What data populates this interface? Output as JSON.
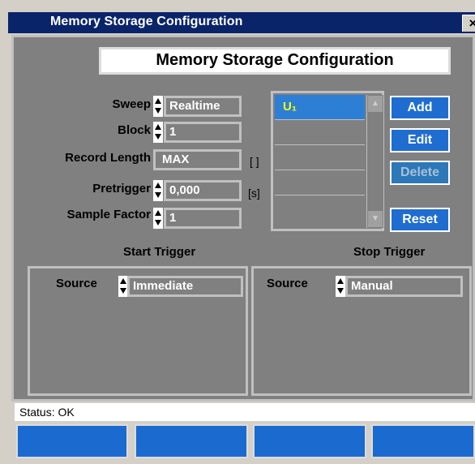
{
  "window": {
    "title": "Memory Storage Configuration",
    "close_label": "×"
  },
  "heading": "Memory Storage Configuration",
  "fields": {
    "sweep": {
      "label": "Sweep",
      "value": "Realtime"
    },
    "block": {
      "label": "Block",
      "value": "1"
    },
    "record_length": {
      "label": "Record Length",
      "value": "MAX",
      "unit": "[ ]"
    },
    "pretrigger": {
      "label": "Pretrigger",
      "value": "0,000",
      "unit": "[s]"
    },
    "sample_factor": {
      "label": "Sample Factor",
      "value": "1"
    }
  },
  "list": {
    "items": [
      "U₁"
    ],
    "selected_index": 0,
    "scroll_up": "▲",
    "scroll_down": "▼"
  },
  "buttons": {
    "add": "Add",
    "edit": "Edit",
    "delete": "Delete",
    "reset": "Reset"
  },
  "start_trigger": {
    "title": "Start Trigger",
    "source_label": "Source",
    "source_value": "Immediate"
  },
  "stop_trigger": {
    "title": "Stop Trigger",
    "source_label": "Source",
    "source_value": "Manual"
  },
  "status": "Status: OK",
  "colors": {
    "titlebar": "#0a246a",
    "panel": "#808080",
    "accent": "#1f6dd0",
    "selection": "#2d7fd6",
    "list_text": "#ffff00"
  },
  "icons": {
    "close": "close-icon",
    "spinner": "spinner-updown-icon"
  }
}
